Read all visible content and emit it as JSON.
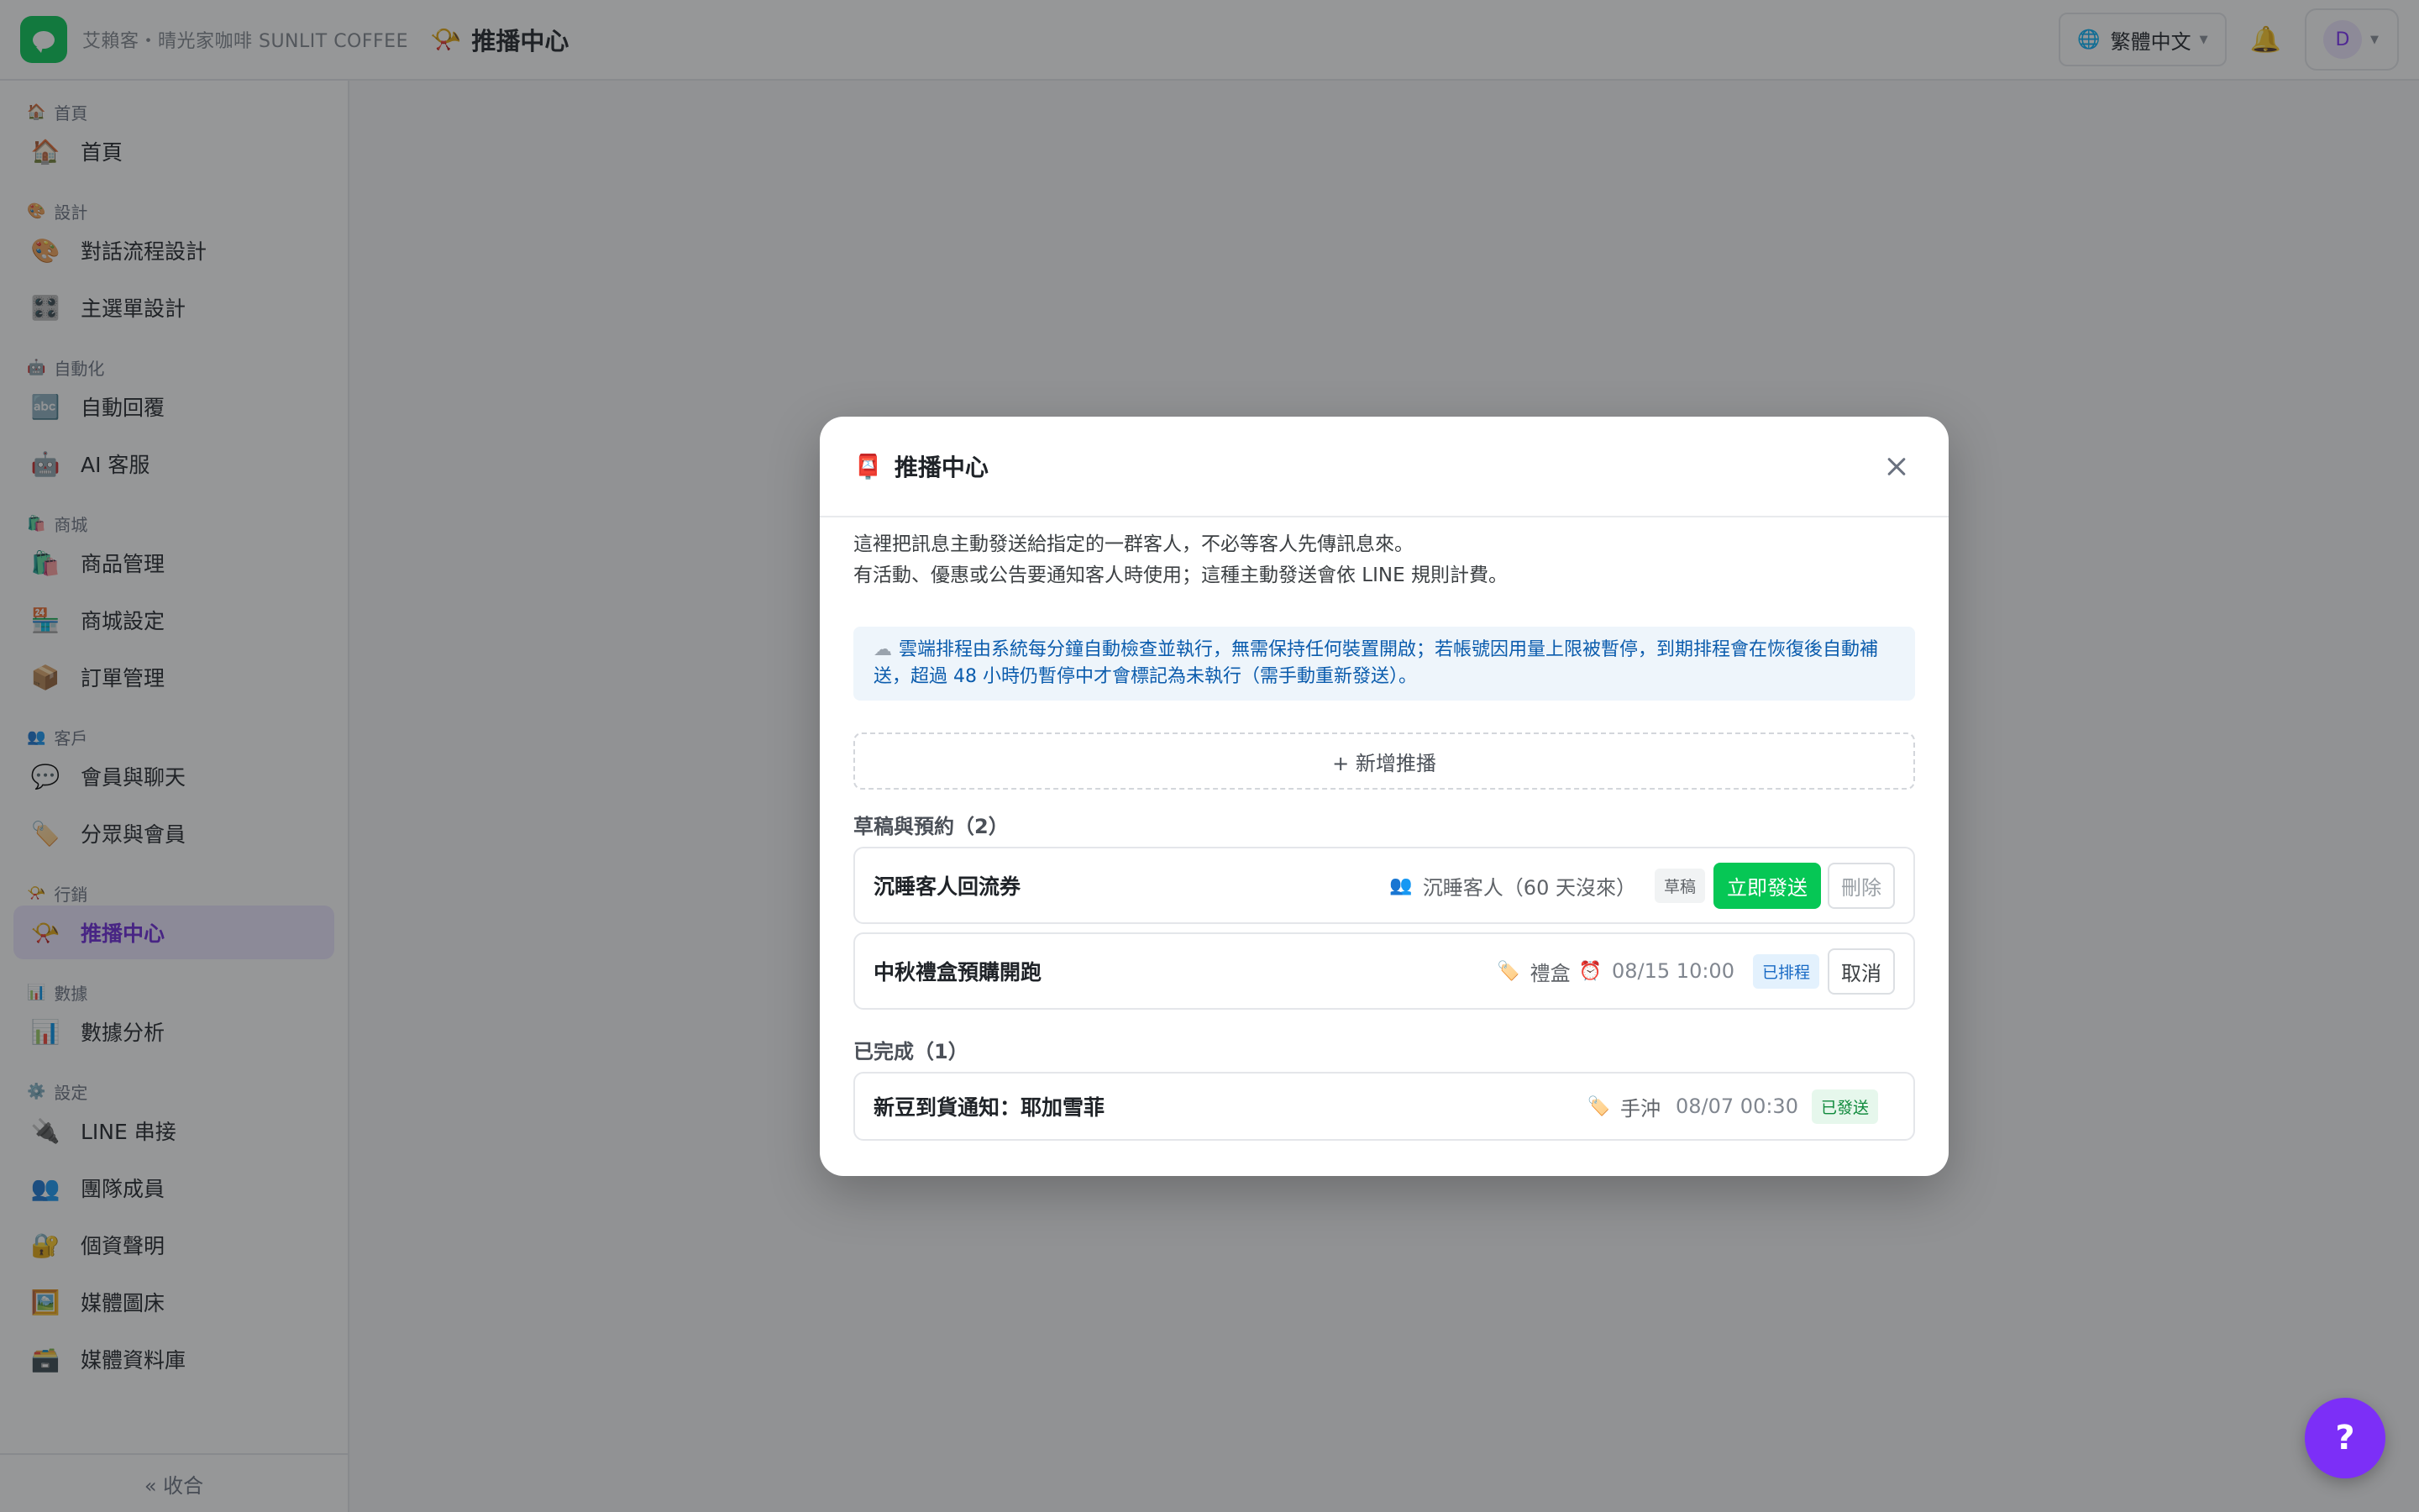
{
  "header": {
    "brand": "艾賴客・晴光家咖啡 SUNLIT COFFEE",
    "page_icon": "📯",
    "page_title": "推播中心",
    "language": "繁體中文",
    "avatar_letter": "D"
  },
  "sidebar": {
    "sections": [
      {
        "label": "首頁",
        "icon": "🏠",
        "items": [
          {
            "icon": "🏠",
            "label": "首頁"
          }
        ]
      },
      {
        "label": "設計",
        "icon": "🎨",
        "items": [
          {
            "icon": "🎨",
            "label": "對話流程設計"
          },
          {
            "icon": "🎛️",
            "label": "主選單設計"
          }
        ]
      },
      {
        "label": "自動化",
        "icon": "🤖",
        "items": [
          {
            "icon": "🔤",
            "label": "自動回覆"
          },
          {
            "icon": "🤖",
            "label": "AI 客服"
          }
        ]
      },
      {
        "label": "商城",
        "icon": "🛍️",
        "items": [
          {
            "icon": "🛍️",
            "label": "商品管理"
          },
          {
            "icon": "🏪",
            "label": "商城設定"
          },
          {
            "icon": "📦",
            "label": "訂單管理"
          }
        ]
      },
      {
        "label": "客戶",
        "icon": "👥",
        "items": [
          {
            "icon": "💬",
            "label": "會員與聊天"
          },
          {
            "icon": "🏷️",
            "label": "分眾與會員"
          }
        ]
      },
      {
        "label": "行銷",
        "icon": "📯",
        "items": [
          {
            "icon": "📯",
            "label": "推播中心",
            "active": true
          }
        ]
      },
      {
        "label": "數據",
        "icon": "📊",
        "items": [
          {
            "icon": "📊",
            "label": "數據分析"
          }
        ]
      },
      {
        "label": "設定",
        "icon": "⚙️",
        "items": [
          {
            "icon": "🔌",
            "label": "LINE 串接"
          },
          {
            "icon": "👥",
            "label": "團隊成員"
          },
          {
            "icon": "🔐",
            "label": "個資聲明"
          },
          {
            "icon": "🖼️",
            "label": "媒體圖床"
          },
          {
            "icon": "🗃️",
            "label": "媒體資料庫"
          }
        ]
      }
    ],
    "collapse_label": "« 收合"
  },
  "modal": {
    "icon": "📮",
    "title": "推播中心",
    "intro_line1": "這裡把訊息主動發送給指定的一群客人，不必等客人先傳訊息來。",
    "intro_line2": "有活動、優惠或公告要通知客人時使用；這種主動發送會依 LINE 規則計費。",
    "notice_icon": "☁",
    "notice": "雲端排程由系統每分鐘自動檢查並執行，無需保持任何裝置開啟；若帳號因用量上限被暫停，到期排程會在恢復後自動補送，超過 48 小時仍暫停中才會標記為未執行（需手動重新發送）。",
    "add_button": "+ 新增推播",
    "drafts_title": "草稿與預約（2）",
    "drafts": [
      {
        "title": "沉睡客人回流券",
        "audience_icon": "👥",
        "audience": "沉睡客人（60 天沒來）",
        "badge": "草稿",
        "primary": "立即發送",
        "secondary": "刪除"
      },
      {
        "title": "中秋禮盒預購開跑",
        "audience_icon": "🏷️",
        "audience": "禮盒",
        "time_icon": "⏰",
        "time": "08/15 10:00",
        "badge": "已排程",
        "secondary": "取消"
      }
    ],
    "done_title": "已完成（1）",
    "done": [
      {
        "title": "新豆到貨通知：耶加雪菲",
        "audience_icon": "🏷️",
        "audience": "手沖",
        "time": "08/07 00:30",
        "badge": "已發送"
      }
    ]
  },
  "help_button": "?",
  "colors": {
    "brand_green": "#06c755",
    "accent_purple": "#7c2ff7",
    "active_bg": "#ece6ff"
  }
}
